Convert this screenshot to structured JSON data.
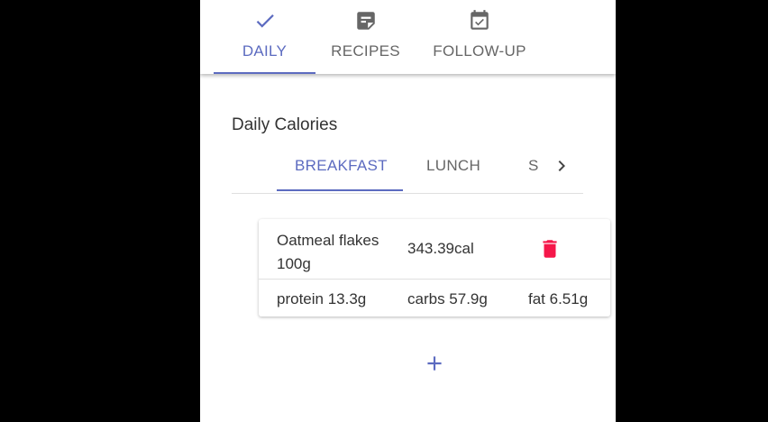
{
  "top_tabs": [
    {
      "label": "DAILY",
      "icon": "check-icon",
      "active": true
    },
    {
      "label": "RECIPES",
      "icon": "note-icon",
      "active": false
    },
    {
      "label": "FOLLOW-UP",
      "icon": "calendar-check-icon",
      "active": false
    }
  ],
  "section": {
    "title": "Daily Calories"
  },
  "meal_tabs": [
    {
      "label": "BREAKFAST",
      "active": true
    },
    {
      "label": "LUNCH",
      "active": false
    },
    {
      "label": "S",
      "active": false
    }
  ],
  "food_items": [
    {
      "name": "Oatmeal flakes 100g",
      "calories": "343.39cal",
      "protein": "protein 13.3g",
      "carbs": "carbs 57.9g",
      "fat": "fat 6.51g"
    }
  ],
  "icons": {
    "delete": "trash-icon",
    "add": "plus-icon",
    "scroll": "chevron-right-icon"
  },
  "colors": {
    "accent": "#5c6bc0",
    "delete": "#f5174a",
    "text": "#333333",
    "muted_tab": "#666666"
  }
}
